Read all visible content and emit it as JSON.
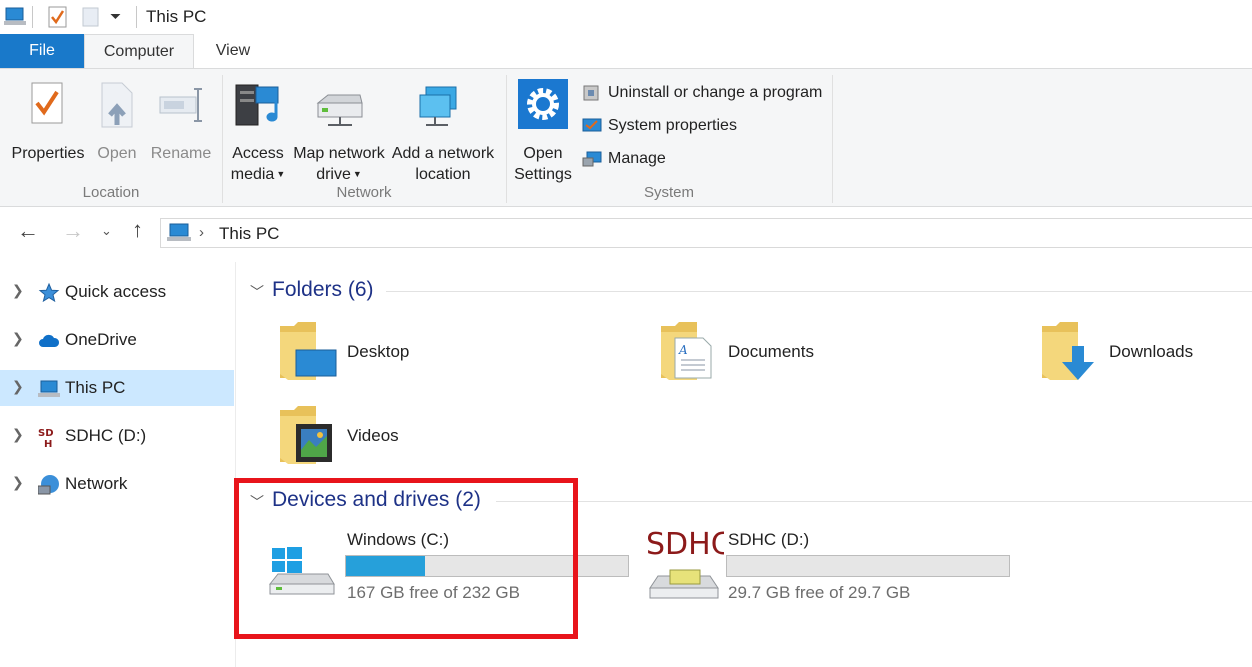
{
  "window": {
    "title": "This PC"
  },
  "tabs": [
    {
      "label": "File"
    },
    {
      "label": "Computer"
    },
    {
      "label": "View"
    }
  ],
  "ribbon": {
    "groups": {
      "location": "Location",
      "network": "Network",
      "system": "System"
    },
    "buttons": {
      "properties": "Properties",
      "open": "Open",
      "rename": "Rename",
      "access_media_1": "Access",
      "access_media_2": "media",
      "map_drive_1": "Map network",
      "map_drive_2": "drive",
      "add_location_1": "Add a network",
      "add_location_2": "location",
      "open_settings_1": "Open",
      "open_settings_2": "Settings",
      "uninstall": "Uninstall or change a program",
      "system_properties": "System properties",
      "manage": "Manage"
    }
  },
  "address": {
    "crumb": "This PC"
  },
  "sidebar": {
    "items": [
      {
        "label": "Quick access"
      },
      {
        "label": "OneDrive"
      },
      {
        "label": "This PC"
      },
      {
        "label": "SDHC (D:)"
      },
      {
        "label": "Network"
      }
    ]
  },
  "content": {
    "folders_header": "Folders (6)",
    "folders": [
      {
        "name": "Desktop"
      },
      {
        "name": "Documents"
      },
      {
        "name": "Downloads"
      },
      {
        "name": "Videos"
      }
    ],
    "devices_header": "Devices and drives (2)",
    "drives": [
      {
        "name": "Windows (C:)",
        "free_text": "167 GB free of 232 GB",
        "used_fraction": 0.28
      },
      {
        "name": "SDHC (D:)",
        "free_text": "29.7 GB free of 29.7 GB",
        "used_fraction": 0.0,
        "logo": "SDHC"
      }
    ]
  },
  "colors": {
    "accent": "#1979ca",
    "selection": "#cce8ff",
    "bar_fill": "#26a0da",
    "highlight": "#e8141b",
    "group_header": "#1e3287"
  }
}
